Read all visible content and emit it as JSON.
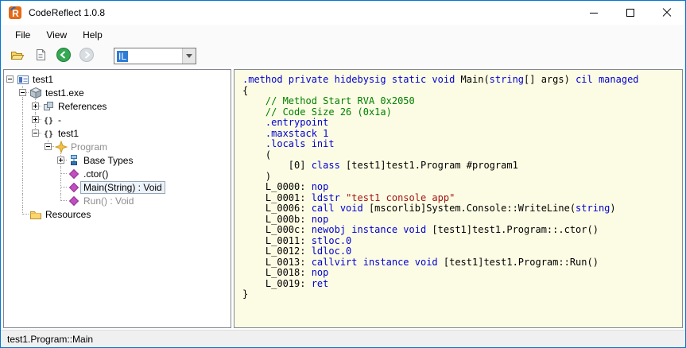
{
  "window": {
    "title": "CodeReflect 1.0.8"
  },
  "menu": {
    "items": [
      {
        "label": "File"
      },
      {
        "label": "View"
      },
      {
        "label": "Help"
      }
    ]
  },
  "toolbar": {
    "buttons": [
      {
        "name": "open-assembly-button",
        "icon": "open-folder-icon",
        "enabled": true
      },
      {
        "name": "assembly-info-button",
        "icon": "document-icon",
        "enabled": true
      },
      {
        "name": "back-button",
        "icon": "back-arrow-icon",
        "enabled": true
      },
      {
        "name": "forward-button",
        "icon": "forward-arrow-icon",
        "enabled": false
      }
    ],
    "language_combo": {
      "value": "IL",
      "selected": true
    }
  },
  "tree": {
    "items": [
      {
        "depth": 0,
        "expander": "minus",
        "icon": "solution-icon",
        "label": "test1"
      },
      {
        "depth": 1,
        "expander": "minus",
        "icon": "assembly-icon",
        "label": "test1.exe"
      },
      {
        "depth": 2,
        "expander": "plus",
        "icon": "references-icon",
        "label": "References"
      },
      {
        "depth": 2,
        "expander": "plus",
        "icon": "namespace-icon",
        "label": "-"
      },
      {
        "depth": 2,
        "expander": "minus",
        "icon": "namespace-icon",
        "label": "test1"
      },
      {
        "depth": 3,
        "expander": "minus",
        "icon": "class-icon",
        "label": "Program",
        "gray": true
      },
      {
        "depth": 4,
        "expander": "plus",
        "icon": "basetypes-icon",
        "label": "Base Types"
      },
      {
        "depth": 4,
        "expander": "none",
        "icon": "method-icon",
        "label": ".ctor()"
      },
      {
        "depth": 4,
        "expander": "none",
        "icon": "method-icon",
        "label": "Main(String) : Void",
        "selected": true
      },
      {
        "depth": 4,
        "expander": "none",
        "icon": "method-icon",
        "label": "Run() : Void",
        "gray": true
      },
      {
        "depth": 1,
        "expander": "none",
        "icon": "folder-icon",
        "label": "Resources"
      }
    ]
  },
  "code": {
    "lines": [
      [
        {
          "t": ".method private hidebysig static void ",
          "c": "kw"
        },
        {
          "t": "Main(",
          "c": "pl"
        },
        {
          "t": "string",
          "c": "kw"
        },
        {
          "t": "[] args) ",
          "c": "pl"
        },
        {
          "t": "cil managed",
          "c": "kw"
        }
      ],
      [
        {
          "t": "{",
          "c": "pl"
        }
      ],
      [
        {
          "t": "    // Method Start RVA 0x2050",
          "c": "cm"
        }
      ],
      [
        {
          "t": "    // Code Size 26 (0x1a)",
          "c": "cm"
        }
      ],
      [
        {
          "t": "    .entrypoint",
          "c": "kw"
        }
      ],
      [
        {
          "t": "    .maxstack 1",
          "c": "kw"
        }
      ],
      [
        {
          "t": "    .locals init",
          "c": "kw"
        }
      ],
      [
        {
          "t": "    (",
          "c": "pl"
        }
      ],
      [
        {
          "t": "        [0] ",
          "c": "pl"
        },
        {
          "t": "class",
          "c": "kw"
        },
        {
          "t": " [test1]test1.Program #program1",
          "c": "pl"
        }
      ],
      [
        {
          "t": "    )",
          "c": "pl"
        }
      ],
      [
        {
          "t": "    L_0000: ",
          "c": "pl"
        },
        {
          "t": "nop",
          "c": "kw"
        }
      ],
      [
        {
          "t": "    L_0001: ",
          "c": "pl"
        },
        {
          "t": "ldstr ",
          "c": "kw"
        },
        {
          "t": "\"test1 console app\"",
          "c": "str"
        }
      ],
      [
        {
          "t": "    L_0006: ",
          "c": "pl"
        },
        {
          "t": "call void ",
          "c": "kw"
        },
        {
          "t": "[mscorlib]System.Console::WriteLine(",
          "c": "pl"
        },
        {
          "t": "string",
          "c": "kw"
        },
        {
          "t": ")",
          "c": "pl"
        }
      ],
      [
        {
          "t": "    L_000b: ",
          "c": "pl"
        },
        {
          "t": "nop",
          "c": "kw"
        }
      ],
      [
        {
          "t": "    L_000c: ",
          "c": "pl"
        },
        {
          "t": "newobj instance void ",
          "c": "kw"
        },
        {
          "t": "[test1]test1.Program::.ctor()",
          "c": "pl"
        }
      ],
      [
        {
          "t": "    L_0011: ",
          "c": "pl"
        },
        {
          "t": "stloc.0",
          "c": "kw"
        }
      ],
      [
        {
          "t": "    L_0012: ",
          "c": "pl"
        },
        {
          "t": "ldloc.0",
          "c": "kw"
        }
      ],
      [
        {
          "t": "    L_0013: ",
          "c": "pl"
        },
        {
          "t": "callvirt instance void ",
          "c": "kw"
        },
        {
          "t": "[test1]test1.Program::Run()",
          "c": "pl"
        }
      ],
      [
        {
          "t": "    L_0018: ",
          "c": "pl"
        },
        {
          "t": "nop",
          "c": "kw"
        }
      ],
      [
        {
          "t": "    L_0019: ",
          "c": "pl"
        },
        {
          "t": "ret",
          "c": "kw"
        }
      ],
      [
        {
          "t": "}",
          "c": "pl"
        }
      ]
    ]
  },
  "statusbar": {
    "text": "test1.Program::Main"
  },
  "colors": {
    "accent": "#0078D7",
    "code_background": "#FCFCE4",
    "keyword": "#0000D4",
    "comment": "#008000",
    "string": "#A31515",
    "plain": "#000000",
    "grayed_text": "#8C8C8C"
  }
}
